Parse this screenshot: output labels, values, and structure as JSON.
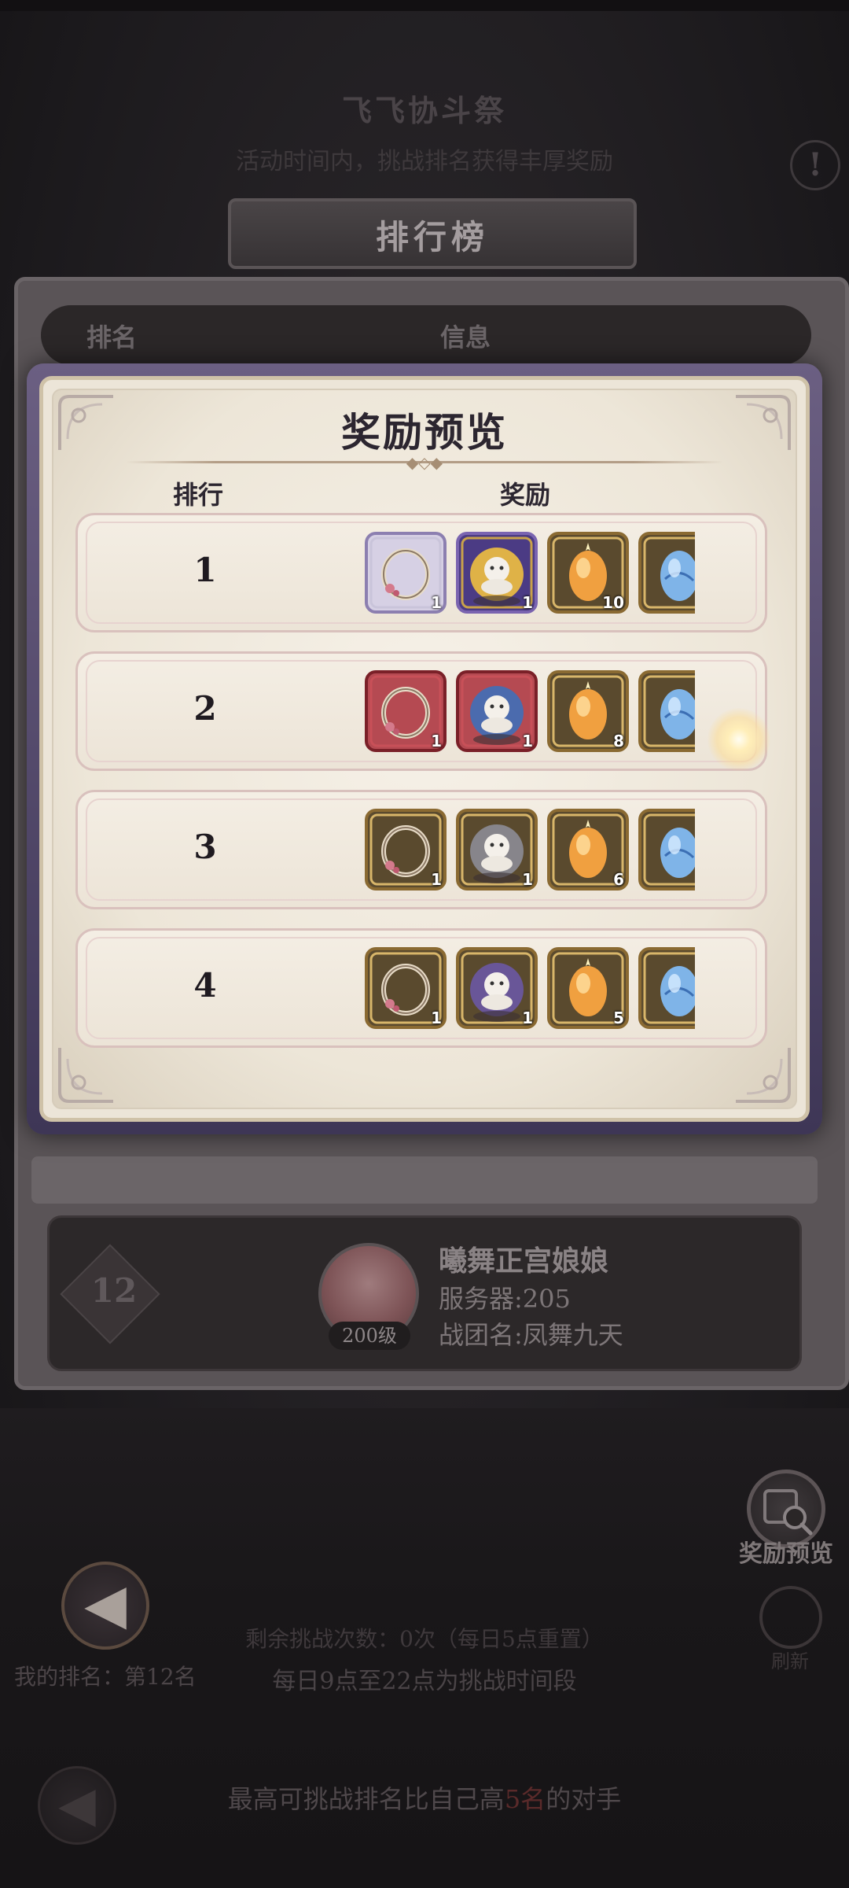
{
  "background": {
    "event_title": "飞飞协斗祭",
    "event_subtitle": "活动时间内，挑战排名获得丰厚奖励",
    "info_icon_glyph": "!",
    "back_icon_glyph": "◀",
    "my_rank_text": "我的排名：第12名",
    "remaining_text": "剩余挑战次数：0次（每日5点重置）",
    "schedule_text": "每日9点至22点为挑战时间段",
    "challenge_rule": {
      "prefix": "最高可挑战排名比自己高",
      "highlight": "5名",
      "suffix": "的对手"
    },
    "reward_preview_btn_label": "奖励预览",
    "refresh_btn_label": "刷新"
  },
  "leaderboard": {
    "title": "排行榜",
    "col_rank": "排名",
    "col_info": "信息",
    "my_entry": {
      "rank": "12",
      "level": "200级",
      "name": "曦舞正宫娘娘",
      "server": "服务器:205",
      "guild": "战团名:凤舞九天"
    }
  },
  "reward_dialog": {
    "title": "奖励预览",
    "col_rank": "排行",
    "col_reward": "奖励",
    "rows": [
      {
        "rank": "1",
        "items": [
          {
            "icon": "ring-icon",
            "frame": "silver-purple",
            "qty": "1"
          },
          {
            "icon": "gold-figurine-icon",
            "frame": "gold-purple",
            "qty": "1"
          },
          {
            "icon": "orange-egg-icon",
            "frame": "gold",
            "qty": "10"
          },
          {
            "icon": "blue-egg-icon",
            "frame": "gold",
            "qty": ""
          }
        ]
      },
      {
        "rank": "2",
        "items": [
          {
            "icon": "ring-icon",
            "frame": "red",
            "qty": "1"
          },
          {
            "icon": "blue-figurine-icon",
            "frame": "red",
            "qty": "1"
          },
          {
            "icon": "orange-egg-icon",
            "frame": "gold",
            "qty": "8"
          },
          {
            "icon": "blue-egg-icon",
            "frame": "gold",
            "qty": ""
          }
        ]
      },
      {
        "rank": "3",
        "items": [
          {
            "icon": "ring-icon",
            "frame": "gold",
            "qty": "1"
          },
          {
            "icon": "silver-figurine-icon",
            "frame": "gold",
            "qty": "1"
          },
          {
            "icon": "orange-egg-icon",
            "frame": "gold",
            "qty": "6"
          },
          {
            "icon": "blue-egg-icon",
            "frame": "gold",
            "qty": ""
          }
        ]
      },
      {
        "rank": "4",
        "items": [
          {
            "icon": "ring-icon",
            "frame": "gold",
            "qty": "1"
          },
          {
            "icon": "purple-figurine-icon",
            "frame": "gold",
            "qty": "1"
          },
          {
            "icon": "orange-egg-icon",
            "frame": "gold",
            "qty": "5"
          },
          {
            "icon": "blue-egg-icon",
            "frame": "gold",
            "qty": ""
          }
        ]
      }
    ]
  },
  "colors": {
    "dialog_bg": "#ede6d8",
    "frame_gold": "#b08a48",
    "frame_red": "#8e2c34",
    "frame_purple": "#5a4a86",
    "text_dark": "#1f1a20"
  }
}
